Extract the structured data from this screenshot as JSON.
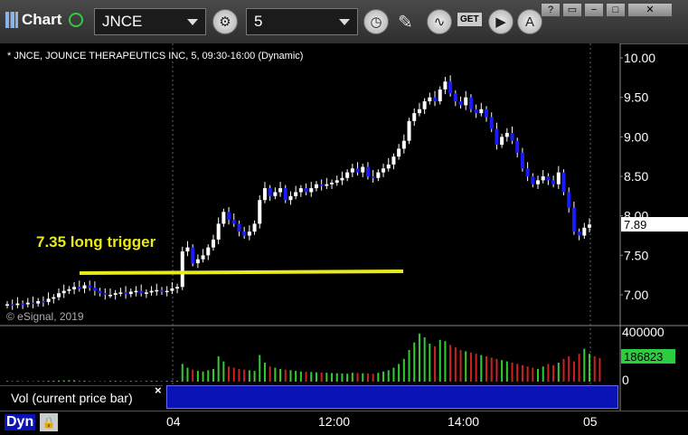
{
  "toolbar": {
    "title": "Chart",
    "symbol": "JNCE",
    "interval": "5",
    "window_buttons": [
      "?",
      "−",
      "□",
      "✕"
    ],
    "get_label": "GET"
  },
  "chart": {
    "title": "* JNCE, JOUNCE THERAPEUTICS INC, 5, 09:30-16:00 (Dynamic)",
    "watermark": "© eSignal, 2019",
    "annotation": "7.35 long trigger",
    "current_price_label": "7.89",
    "annotation_color": "#e8ea1a",
    "up_color": "#ffffff",
    "down_color": "#1b1bff"
  },
  "volume_panel": {
    "label": "Vol (current price bar)",
    "close": "×",
    "current_volume": "186823",
    "axis_labels": [
      "400000",
      "0"
    ]
  },
  "bottom": {
    "mode": "Dyn",
    "x_ticks": [
      "04",
      "12:00",
      "14:00",
      "05"
    ]
  },
  "chart_data": {
    "type": "candlestick",
    "title": "* JNCE, JOUNCE THERAPEUTICS INC, 5, 09:30-16:00 (Dynamic)",
    "y_ticks": [
      "10.00",
      "9.50",
      "9.00",
      "8.50",
      "8.00",
      "7.50",
      "7.00"
    ],
    "ylim": [
      6.7,
      10.1
    ],
    "x_ticks": [
      "04",
      "12:00",
      "14:00",
      "05"
    ],
    "closes": [
      6.88,
      6.87,
      6.89,
      6.88,
      6.9,
      6.89,
      6.92,
      6.91,
      6.95,
      6.97,
      7.02,
      7.05,
      7.07,
      7.1,
      7.08,
      7.12,
      7.09,
      7.05,
      7.02,
      7.0,
      7.0,
      7.02,
      7.03,
      7.01,
      7.04,
      7.05,
      7.02,
      7.03,
      7.05,
      7.06,
      7.04,
      7.05,
      7.08,
      7.1,
      7.55,
      7.6,
      7.4,
      7.45,
      7.5,
      7.6,
      7.7,
      7.9,
      8.05,
      7.95,
      7.9,
      7.8,
      7.75,
      7.8,
      7.9,
      8.2,
      8.35,
      8.25,
      8.3,
      8.35,
      8.2,
      8.25,
      8.3,
      8.35,
      8.3,
      8.35,
      8.4,
      8.38,
      8.4,
      8.42,
      8.45,
      8.48,
      8.55,
      8.6,
      8.55,
      8.62,
      8.5,
      8.48,
      8.55,
      8.6,
      8.65,
      8.75,
      8.85,
      8.95,
      9.2,
      9.3,
      9.35,
      9.45,
      9.5,
      9.45,
      9.6,
      9.7,
      9.55,
      9.45,
      9.4,
      9.5,
      9.35,
      9.3,
      9.35,
      9.25,
      9.1,
      8.9,
      9.0,
      9.05,
      8.95,
      8.8,
      8.6,
      8.5,
      8.4,
      8.45,
      8.5,
      8.45,
      8.4,
      8.55,
      8.3,
      8.1,
      7.8,
      7.75,
      7.85,
      7.89
    ],
    "trigger_line": 7.3,
    "volumes": [
      6000,
      5000,
      5500,
      4000,
      4500,
      5000,
      4800,
      6000,
      7000,
      8000,
      9000,
      10000,
      12000,
      11000,
      9000,
      8000,
      7000,
      6000,
      5000,
      5500,
      6000,
      5800,
      5200,
      6200,
      5900,
      6100,
      5800,
      6000,
      6300,
      6400,
      6200,
      6500,
      7000,
      8000,
      140000,
      110000,
      95000,
      85000,
      80000,
      90000,
      100000,
      200000,
      160000,
      120000,
      110000,
      100000,
      95000,
      90000,
      85000,
      210000,
      150000,
      120000,
      110000,
      100000,
      95000,
      90000,
      85000,
      80000,
      78000,
      76000,
      74000,
      72000,
      70000,
      68000,
      66000,
      64000,
      62000,
      70000,
      68000,
      66000,
      64000,
      62000,
      70000,
      80000,
      90000,
      110000,
      140000,
      180000,
      250000,
      310000,
      380000,
      350000,
      300000,
      280000,
      330000,
      320000,
      290000,
      270000,
      250000,
      240000,
      230000,
      220000,
      210000,
      200000,
      190000,
      180000,
      170000,
      160000,
      150000,
      140000,
      130000,
      120000,
      110000,
      100000,
      120000,
      140000,
      130000,
      150000,
      180000,
      200000,
      160000,
      220000,
      260000,
      220000,
      200000,
      186823
    ],
    "vol_ylim": [
      0,
      400000
    ]
  }
}
